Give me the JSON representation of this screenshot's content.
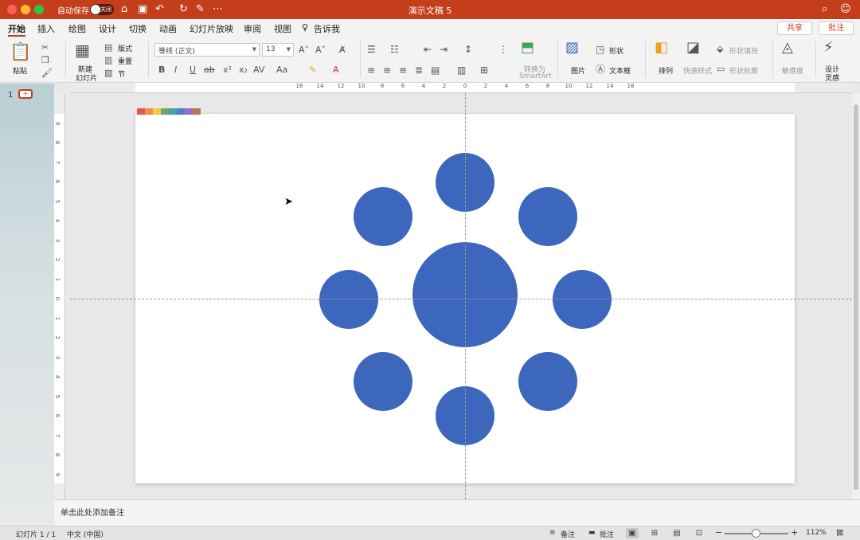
{
  "titlebar": {
    "autosave_label": "自动保存",
    "autosave_state": "关闭",
    "doc_title": "演示文稿 5"
  },
  "tabs": [
    "开始",
    "插入",
    "绘图",
    "设计",
    "切换",
    "动画",
    "幻灯片放映",
    "审阅",
    "视图"
  ],
  "tell_me": "告诉我",
  "share_label": "共享",
  "comment_label": "批注",
  "ribbon": {
    "paste": "粘贴",
    "new_slide_1": "新建",
    "new_slide_2": "幻灯片",
    "layout": "版式",
    "reset": "重置",
    "section": "节",
    "font_name": "等线 (正文)",
    "font_size": "13",
    "convert_1": "转换为",
    "convert_2": "SmartArt",
    "picture": "图片",
    "shape": "形状",
    "textbox": "文本框",
    "arrange": "排列",
    "quick_styles": "快速样式",
    "shape_fill": "形状填充",
    "shape_outline": "形状轮廓",
    "sensitivity": "敏感度",
    "designer_1": "设计",
    "designer_2": "灵感"
  },
  "thumbnail": {
    "number": "1"
  },
  "ruler": {
    "h_ticks": [
      "16",
      "14",
      "12",
      "10",
      "8",
      "6",
      "4",
      "2",
      "0",
      "2",
      "4",
      "6",
      "8",
      "10",
      "12",
      "14",
      "16"
    ],
    "v_ticks": [
      "9",
      "8",
      "7",
      "6",
      "5",
      "4",
      "3",
      "2",
      "1",
      "0",
      "1",
      "2",
      "3",
      "4",
      "5",
      "6",
      "7",
      "8",
      "9"
    ]
  },
  "slide": {
    "shape_color": "#3d66bd",
    "palette": [
      "#e05757",
      "#f08f4a",
      "#f4c84b",
      "#6aaa6b",
      "#4aa0a8",
      "#4f7ec9",
      "#9b6fc5",
      "#b07a55"
    ]
  },
  "notes_placeholder": "单击此处添加备注",
  "status": {
    "slide_count": "幻灯片 1 / 1",
    "language": "中文 (中国)",
    "notes": "备注",
    "comments": "批注",
    "zoom": "112%"
  }
}
